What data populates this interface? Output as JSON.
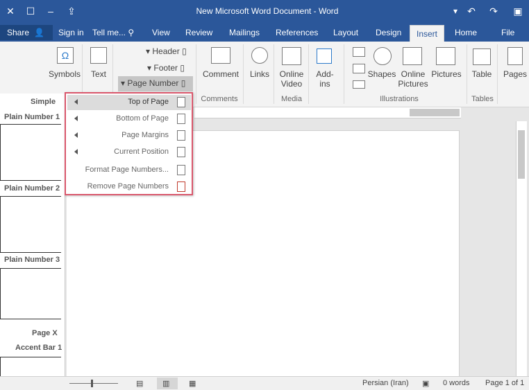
{
  "window": {
    "title": "New Microsoft Word Document - Word"
  },
  "tabs": [
    "File",
    "Home",
    "Insert",
    "Design",
    "Layout",
    "References",
    "Mailings",
    "Review",
    "View"
  ],
  "tell_me": "Tell me...",
  "sign_in": "Sign in",
  "share": "Share",
  "ribbon": {
    "pages": "Pages",
    "table": "Table",
    "tables_group": "Tables",
    "pictures": "Pictures",
    "online_pictures": "Online Pictures",
    "shapes": "Shapes",
    "illustrations_group": "Illustrations",
    "addins": "Add-ins",
    "online_video": "Online Video",
    "media_group": "Media",
    "links": "Links",
    "comment": "Comment",
    "comments_group": "Comments",
    "header": "Header",
    "footer": "Footer",
    "page_number": "Page Number",
    "text": "Text",
    "symbols": "Symbols"
  },
  "menu": {
    "items": [
      "Top of Page",
      "Bottom of Page",
      "Page Margins",
      "Current Position",
      "Format Page Numbers...",
      "Remove Page Numbers"
    ]
  },
  "gallery": {
    "items": [
      "Simple",
      "Plain Number 1",
      "Plain Number 2",
      "Plain Number 3",
      "Page X",
      "Accent Bar 1"
    ]
  },
  "status": {
    "page": "Page 1 of 1",
    "words": "0 words",
    "language": "Persian (Iran)"
  }
}
